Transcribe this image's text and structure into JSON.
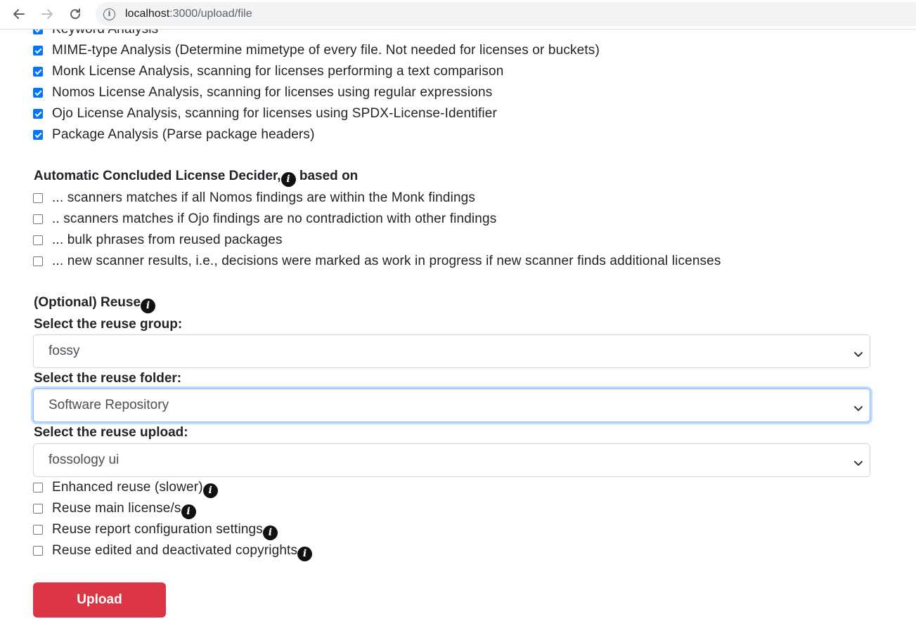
{
  "browser": {
    "url_host": "localhost",
    "url_path": ":3000/upload/file",
    "back_icon": "arrow-left-icon",
    "forward_icon": "arrow-right-icon",
    "reload_icon": "reload-icon",
    "site_info_icon": "info-circle-icon"
  },
  "analysis": {
    "items": [
      {
        "label": "Keyword Analysis",
        "checked": true
      },
      {
        "label": "MIME-type Analysis (Determine mimetype of every file. Not needed for licenses or buckets)",
        "checked": true
      },
      {
        "label": "Monk License Analysis, scanning for licenses performing a text comparison",
        "checked": true
      },
      {
        "label": "Nomos License Analysis, scanning for licenses using regular expressions",
        "checked": true
      },
      {
        "label": "Ojo License Analysis, scanning for licenses using SPDX-License-Identifier",
        "checked": true
      },
      {
        "label": "Package Analysis (Parse package headers)",
        "checked": true
      }
    ]
  },
  "decider": {
    "heading_part1": "Automatic Concluded License Decider,",
    "heading_part2": " based on",
    "items": [
      {
        "label": "... scanners matches if all Nomos findings are within the Monk findings",
        "checked": false
      },
      {
        "label": ".. scanners matches if Ojo findings are no contradiction with other findings",
        "checked": false
      },
      {
        "label": "... bulk phrases from reused packages",
        "checked": false
      },
      {
        "label": "... new scanner results, i.e., decisions were marked as work in progress if new scanner finds additional licenses",
        "checked": false
      }
    ]
  },
  "reuse": {
    "heading": "(Optional) Reuse",
    "group_label": "Select the reuse group:",
    "group_value": "fossy",
    "folder_label": "Select the reuse folder:",
    "folder_value": "Software Repository",
    "upload_label": "Select the reuse upload:",
    "upload_value": "fossology ui",
    "options": [
      {
        "label": "Enhanced reuse (slower)",
        "checked": false
      },
      {
        "label": "Reuse main license/s",
        "checked": false
      },
      {
        "label": "Reuse report configuration settings",
        "checked": false
      },
      {
        "label": "Reuse edited and deactivated copyrights",
        "checked": false
      }
    ]
  },
  "info_glyph": "i",
  "upload_button": "Upload",
  "colors": {
    "checkbox_checked": "#0075ff",
    "upload_button_bg": "#dc3545",
    "focus_ring": "#86b7fe"
  }
}
